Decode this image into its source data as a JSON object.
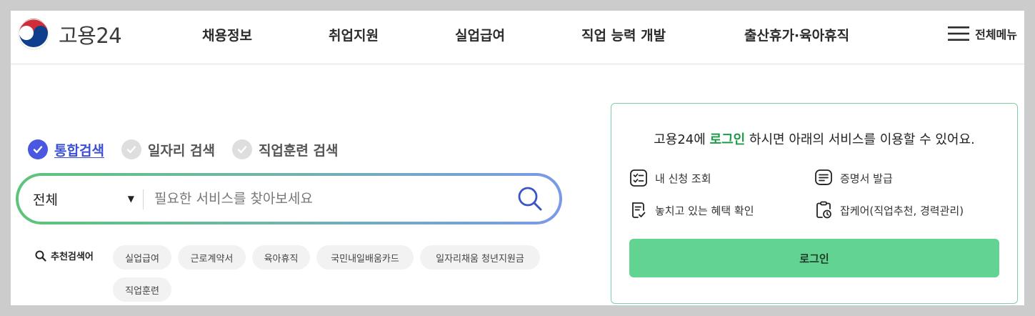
{
  "header": {
    "logo_text": "고용24",
    "nav": [
      "채용정보",
      "취업지원",
      "실업급여",
      "직업 능력 개발",
      "출산휴가·육아휴직"
    ],
    "all_menu_label": "전체메뉴"
  },
  "search": {
    "tabs": [
      {
        "label": "통합검색",
        "active": true
      },
      {
        "label": "일자리 검색",
        "active": false
      },
      {
        "label": "직업훈련 검색",
        "active": false
      }
    ],
    "category_value": "전체",
    "placeholder": "필요한 서비스를 찾아보세요",
    "recommended_label": "추천검색어",
    "recommended": [
      "실업급여",
      "근로계약서",
      "육아휴직",
      "국민내일배움카드",
      "일자리채움 청년지원금",
      "직업훈련"
    ]
  },
  "login_panel": {
    "title_prefix": "고용24에 ",
    "title_highlight": "로그인",
    "title_suffix": " 하시면 아래의 서비스를 이용할 수 있어요.",
    "services": [
      {
        "label": "내 신청 조회",
        "icon": "checklist-icon"
      },
      {
        "label": "증명서 발급",
        "icon": "certificate-icon"
      },
      {
        "label": "놓치고 있는 혜택 확인",
        "icon": "benefit-doc-icon"
      },
      {
        "label": "잡케어(직업추천, 경력관리)",
        "icon": "clipboard-clock-icon"
      }
    ],
    "login_button": "로그인"
  },
  "colors": {
    "accent_blue": "#4a57e0",
    "login_green": "#62d390",
    "highlight_green": "#1f9a4a",
    "panel_border": "#7fcfa4"
  }
}
